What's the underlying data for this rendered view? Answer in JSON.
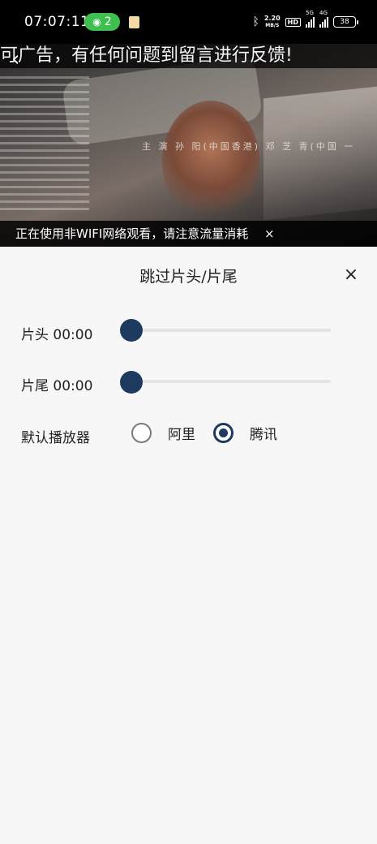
{
  "status_bar": {
    "time": "07:07:11",
    "hotspot_count": "2",
    "net_speed_value": "2.20",
    "net_speed_unit": "MB/S",
    "hd_label": "HD",
    "sim1_tag": "5G",
    "sim2_tag": "4G",
    "battery_level": "38",
    "icons": [
      "wifi-hotspot-icon",
      "note-icon",
      "bluetooth-icon",
      "signal-icon",
      "battery-icon"
    ]
  },
  "video": {
    "marquee_text": "可广告，有任何问题到留言进行反馈!",
    "credits_text": "主  演  孙  阳(中国香港)  邓 芝 青(中国 一",
    "network_warning": "正在使用非WIFI网络观看，请注意流量消耗",
    "close_symbol": "×",
    "back_symbol": "‹"
  },
  "skip_panel": {
    "title": "跳过片头/片尾",
    "close_symbol": "×",
    "intro_label": "片头 00:00",
    "intro_value": 0,
    "outro_label": "片尾 00:00",
    "outro_value": 0,
    "player_label": "默认播放器",
    "player_options": [
      {
        "label": "阿里",
        "selected": false
      },
      {
        "label": "腾讯",
        "selected": true
      }
    ]
  },
  "colors": {
    "accent": "#1e3a5f",
    "hotspot_green": "#3fbf4f",
    "panel_bg": "#f7f7f7"
  }
}
